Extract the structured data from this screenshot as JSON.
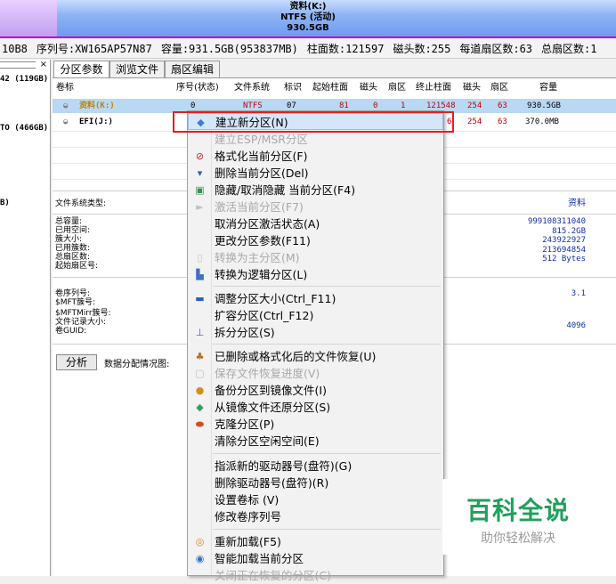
{
  "disk_header": {
    "name": "资料(K:)",
    "fs": "NTFS (活动)",
    "size": "930.5GB"
  },
  "infobar": {
    "model_tail": "10B8",
    "serial": "序列号:XW165AP57N87",
    "capacity": "容量:931.5GB(953837MB)",
    "cylinders": "柱面数:121597",
    "heads": "磁头数:255",
    "sectors_per_track": "每道扇区数:63",
    "total_sectors": "总扇区数:1"
  },
  "left_panel": {
    "close_glyph": "×",
    "entries": [
      "42 (119GB)",
      "TO (466GB)",
      "B)"
    ]
  },
  "tabs": [
    "分区参数",
    "浏览文件",
    "扇区编辑"
  ],
  "table": {
    "headers": [
      "卷标",
      "序号(状态)",
      "文件系统",
      "标识",
      "起始柱面",
      "磁头",
      "扇区",
      "终止柱面",
      "磁头",
      "扇区",
      "容量"
    ],
    "rows": [
      {
        "label": "资料(K:)",
        "idx": "0",
        "fs": "NTFS",
        "id": "07",
        "start_cyl": "81",
        "start_head": "0",
        "start_sec": "1",
        "end_cyl": "121548",
        "end_head": "254",
        "end_sec": "63",
        "cap": "930.5GB"
      },
      {
        "label": "EFI(J:)",
        "end_cyl_partial": "6",
        "end_head": "254",
        "end_sec": "63",
        "cap": "370.0MB"
      }
    ]
  },
  "details": {
    "fs_type_label": "文件系统类型:",
    "fs_type_value": "资料",
    "group1_labels": [
      "总容量:",
      "已用空间:",
      "簇大小:",
      "已用簇数:",
      "总扇区数:",
      "起始扇区号:"
    ],
    "group1_values": [
      "999108311040",
      "815.2GB",
      "243922927",
      "213694854",
      "512 Bytes"
    ],
    "group2_labels": [
      "卷序列号:",
      "$MFT簇号:",
      "$MFTMirr簇号:",
      "文件记录大小:",
      "卷GUID:"
    ],
    "group2_values": [
      "3.1",
      "4096"
    ],
    "analyze_button": "分析",
    "analyze_label": "数据分配情况图:"
  },
  "context_menu": {
    "items": [
      {
        "label": "建立新分区(N)",
        "icon": "new-partition-icon",
        "disabled": false
      },
      {
        "label": "建立ESP/MSR分区",
        "icon": "",
        "disabled": true
      },
      {
        "label": "格式化当前分区(F)",
        "icon": "format-icon",
        "disabled": false
      },
      {
        "label": "删除当前分区(Del)",
        "icon": "delete-icon",
        "disabled": false
      },
      {
        "label": "隐藏/取消隐藏 当前分区(F4)",
        "icon": "hide-icon",
        "disabled": false
      },
      {
        "label": "激活当前分区(F7)",
        "icon": "activate-icon",
        "disabled": true
      },
      {
        "label": "取消分区激活状态(A)",
        "icon": "",
        "disabled": false
      },
      {
        "label": "更改分区参数(F11)",
        "icon": "",
        "disabled": false
      },
      {
        "label": "转换为主分区(M)",
        "icon": "primary-icon",
        "disabled": true
      },
      {
        "label": "转换为逻辑分区(L)",
        "icon": "logical-icon",
        "disabled": false
      },
      {
        "label": "调整分区大小(Ctrl_F11)",
        "icon": "resize-icon",
        "disabled": false
      },
      {
        "label": "扩容分区(Ctrl_F12)",
        "icon": "",
        "disabled": false
      },
      {
        "label": "拆分分区(S)",
        "icon": "split-icon",
        "disabled": false
      },
      {
        "label": "已删除或格式化后的文件恢复(U)",
        "icon": "recover-icon",
        "disabled": false
      },
      {
        "label": "保存文件恢复进度(V)",
        "icon": "save-progress-icon",
        "disabled": true
      },
      {
        "label": "备份分区到镜像文件(I)",
        "icon": "backup-icon",
        "disabled": false
      },
      {
        "label": "从镜像文件还原分区(S)",
        "icon": "restore-icon",
        "disabled": false
      },
      {
        "label": "克隆分区(P)",
        "icon": "clone-icon",
        "disabled": false
      },
      {
        "label": "清除分区空闲空间(E)",
        "icon": "",
        "disabled": false
      },
      {
        "label": "指派新的驱动器号(盘符)(G)",
        "icon": "",
        "disabled": false
      },
      {
        "label": "删除驱动器号(盘符)(R)",
        "icon": "",
        "disabled": false
      },
      {
        "label": "设置卷标 (V)",
        "icon": "",
        "disabled": false
      },
      {
        "label": "修改卷序列号",
        "icon": "",
        "disabled": false
      },
      {
        "label": "重新加载(F5)",
        "icon": "reload-icon",
        "disabled": false
      },
      {
        "label": "智能加载当前分区",
        "icon": "smart-load-icon",
        "disabled": false
      },
      {
        "label": "关闭正在恢复的分区(C)",
        "icon": "",
        "disabled": true
      }
    ]
  },
  "watermark": {
    "title": "百科全说",
    "subtitle": "助你轻松解决"
  },
  "colors": {
    "header_gradient_top": "#c8dcff",
    "selection": "#b8d8f4",
    "highlight_box": "#e02020",
    "watermark_green": "#21a05c"
  }
}
